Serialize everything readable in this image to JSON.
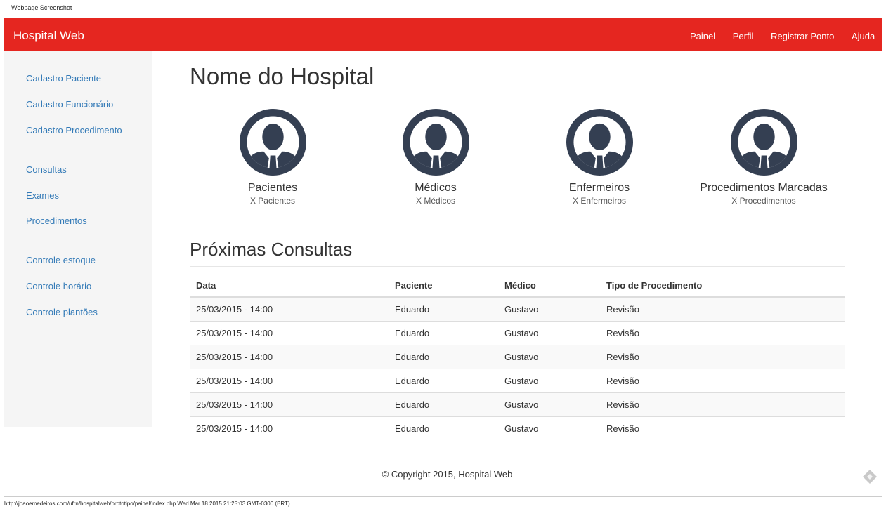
{
  "page_caption": "Webpage Screenshot",
  "navbar": {
    "brand": "Hospital Web",
    "links": [
      "Painel",
      "Perfil",
      "Registrar Ponto",
      "Ajuda"
    ],
    "color": "#e52620"
  },
  "sidebar": {
    "items": [
      "Cadastro Paciente",
      "Cadastro Funcionário",
      "Cadastro Procedimento",
      "Consultas",
      "Exames",
      "Procedimentos",
      "Controle estoque",
      "Controle horário",
      "Controle plantões"
    ],
    "link_color": "#337ab7"
  },
  "main": {
    "title": "Nome do Hospital",
    "stats": [
      {
        "title": "Pacientes",
        "sub": "X Pacientes",
        "icon": "user-avatar-icon"
      },
      {
        "title": "Médicos",
        "sub": "X Médicos",
        "icon": "user-avatar-icon"
      },
      {
        "title": "Enfermeiros",
        "sub": "X Enfermeiros",
        "icon": "user-avatar-icon"
      },
      {
        "title": "Procedimentos Marcadas",
        "sub": "X Procedimentos",
        "icon": "user-avatar-icon"
      }
    ],
    "section_title": "Próximas Consultas",
    "table": {
      "headers": [
        "Data",
        "Paciente",
        "Médico",
        "Tipo de Procedimento"
      ],
      "rows": [
        [
          "25/03/2015 - 14:00",
          "Eduardo",
          "Gustavo",
          "Revisão"
        ],
        [
          "25/03/2015 - 14:00",
          "Eduardo",
          "Gustavo",
          "Revisão"
        ],
        [
          "25/03/2015 - 14:00",
          "Eduardo",
          "Gustavo",
          "Revisão"
        ],
        [
          "25/03/2015 - 14:00",
          "Eduardo",
          "Gustavo",
          "Revisão"
        ],
        [
          "25/03/2015 - 14:00",
          "Eduardo",
          "Gustavo",
          "Revisão"
        ],
        [
          "25/03/2015 - 14:00",
          "Eduardo",
          "Gustavo",
          "Revisão"
        ]
      ]
    }
  },
  "footer": {
    "text": "© Copyright 2015, Hospital Web"
  },
  "url_caption": "http://joaoemedeiros.com/ufrn/hospitalweb/prototipo/painel/index.php Wed Mar 18 2015 21:25:03 GMT-0300 (BRT)",
  "colors": {
    "avatar": "#343f52"
  }
}
